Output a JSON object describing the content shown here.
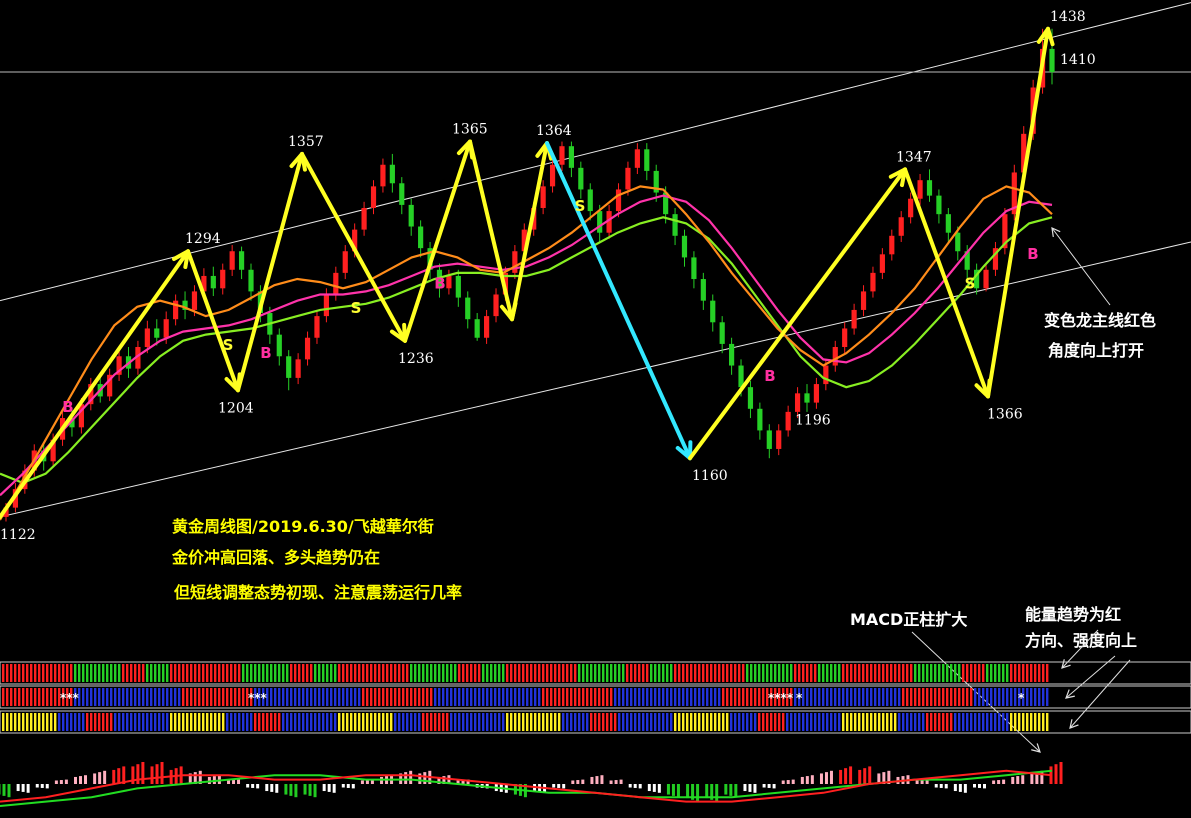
{
  "chart_data": {
    "type": "candlestick",
    "x_range": [
      0,
      1070
    ],
    "price_range": [
      1120,
      1445
    ],
    "candles": [
      [
        1122,
        1128,
        1119,
        1131
      ],
      [
        1128,
        1140,
        1125,
        1144
      ],
      [
        1140,
        1152,
        1137,
        1156
      ],
      [
        1152,
        1165,
        1148,
        1169
      ],
      [
        1165,
        1158,
        1152,
        1170
      ],
      [
        1158,
        1172,
        1155,
        1176
      ],
      [
        1172,
        1186,
        1168,
        1190
      ],
      [
        1186,
        1180,
        1174,
        1192
      ],
      [
        1180,
        1195,
        1176,
        1199
      ],
      [
        1195,
        1208,
        1191,
        1212
      ],
      [
        1208,
        1200,
        1196,
        1214
      ],
      [
        1200,
        1214,
        1197,
        1218
      ],
      [
        1214,
        1226,
        1210,
        1231
      ],
      [
        1226,
        1218,
        1212,
        1232
      ],
      [
        1218,
        1232,
        1214,
        1236
      ],
      [
        1232,
        1244,
        1228,
        1249
      ],
      [
        1244,
        1238,
        1233,
        1250
      ],
      [
        1238,
        1250,
        1234,
        1255
      ],
      [
        1250,
        1262,
        1246,
        1266
      ],
      [
        1262,
        1256,
        1250,
        1268
      ],
      [
        1256,
        1268,
        1252,
        1272
      ],
      [
        1268,
        1278,
        1264,
        1283
      ],
      [
        1278,
        1270,
        1265,
        1284
      ],
      [
        1270,
        1282,
        1266,
        1286
      ],
      [
        1282,
        1294,
        1278,
        1298
      ],
      [
        1294,
        1282,
        1276,
        1297
      ],
      [
        1282,
        1268,
        1262,
        1286
      ],
      [
        1268,
        1254,
        1248,
        1272
      ],
      [
        1254,
        1240,
        1234,
        1258
      ],
      [
        1240,
        1226,
        1220,
        1244
      ],
      [
        1226,
        1212,
        1204,
        1230
      ],
      [
        1212,
        1224,
        1208,
        1228
      ],
      [
        1224,
        1238,
        1220,
        1242
      ],
      [
        1238,
        1252,
        1234,
        1256
      ],
      [
        1252,
        1266,
        1248,
        1270
      ],
      [
        1266,
        1280,
        1262,
        1284
      ],
      [
        1280,
        1294,
        1276,
        1298
      ],
      [
        1294,
        1308,
        1290,
        1312
      ],
      [
        1308,
        1322,
        1304,
        1326
      ],
      [
        1322,
        1336,
        1318,
        1340
      ],
      [
        1336,
        1350,
        1332,
        1354
      ],
      [
        1350,
        1338,
        1332,
        1357
      ],
      [
        1338,
        1324,
        1318,
        1342
      ],
      [
        1324,
        1310,
        1304,
        1328
      ],
      [
        1310,
        1296,
        1290,
        1314
      ],
      [
        1296,
        1282,
        1276,
        1300
      ],
      [
        1282,
        1270,
        1264,
        1286
      ],
      [
        1270,
        1278,
        1266,
        1282
      ],
      [
        1278,
        1264,
        1258,
        1282
      ],
      [
        1264,
        1250,
        1244,
        1268
      ],
      [
        1250,
        1238,
        1236,
        1254
      ],
      [
        1238,
        1252,
        1234,
        1256
      ],
      [
        1252,
        1266,
        1248,
        1270
      ],
      [
        1266,
        1280,
        1262,
        1284
      ],
      [
        1280,
        1294,
        1276,
        1298
      ],
      [
        1294,
        1308,
        1290,
        1312
      ],
      [
        1308,
        1322,
        1304,
        1326
      ],
      [
        1322,
        1336,
        1318,
        1340
      ],
      [
        1336,
        1350,
        1332,
        1354
      ],
      [
        1350,
        1362,
        1346,
        1365
      ],
      [
        1362,
        1348,
        1342,
        1365
      ],
      [
        1348,
        1334,
        1328,
        1352
      ],
      [
        1334,
        1320,
        1314,
        1338
      ],
      [
        1320,
        1306,
        1300,
        1324
      ],
      [
        1306,
        1320,
        1302,
        1324
      ],
      [
        1320,
        1334,
        1316,
        1338
      ],
      [
        1334,
        1348,
        1330,
        1352
      ],
      [
        1348,
        1360,
        1344,
        1364
      ],
      [
        1360,
        1346,
        1340,
        1364
      ],
      [
        1346,
        1332,
        1326,
        1350
      ],
      [
        1332,
        1318,
        1312,
        1336
      ],
      [
        1318,
        1304,
        1298,
        1322
      ],
      [
        1304,
        1290,
        1284,
        1308
      ],
      [
        1290,
        1276,
        1270,
        1294
      ],
      [
        1276,
        1262,
        1256,
        1280
      ],
      [
        1262,
        1248,
        1242,
        1266
      ],
      [
        1248,
        1234,
        1228,
        1252
      ],
      [
        1234,
        1220,
        1214,
        1238
      ],
      [
        1220,
        1206,
        1200,
        1224
      ],
      [
        1206,
        1192,
        1186,
        1210
      ],
      [
        1192,
        1178,
        1172,
        1196
      ],
      [
        1178,
        1166,
        1160,
        1182
      ],
      [
        1166,
        1178,
        1162,
        1182
      ],
      [
        1178,
        1190,
        1174,
        1194
      ],
      [
        1190,
        1202,
        1186,
        1206
      ],
      [
        1202,
        1196,
        1190,
        1208
      ],
      [
        1196,
        1208,
        1192,
        1212
      ],
      [
        1208,
        1220,
        1204,
        1224
      ],
      [
        1220,
        1232,
        1216,
        1236
      ],
      [
        1232,
        1244,
        1228,
        1248
      ],
      [
        1244,
        1256,
        1240,
        1260
      ],
      [
        1256,
        1268,
        1252,
        1272
      ],
      [
        1268,
        1280,
        1264,
        1284
      ],
      [
        1280,
        1292,
        1276,
        1296
      ],
      [
        1292,
        1304,
        1288,
        1308
      ],
      [
        1304,
        1316,
        1300,
        1320
      ],
      [
        1316,
        1328,
        1312,
        1332
      ],
      [
        1328,
        1340,
        1324,
        1344
      ],
      [
        1340,
        1330,
        1326,
        1347
      ],
      [
        1330,
        1318,
        1312,
        1334
      ],
      [
        1318,
        1306,
        1300,
        1322
      ],
      [
        1306,
        1294,
        1288,
        1310
      ],
      [
        1294,
        1282,
        1276,
        1298
      ],
      [
        1282,
        1270,
        1266,
        1286
      ],
      [
        1270,
        1282,
        1268,
        1286
      ],
      [
        1282,
        1296,
        1278,
        1300
      ],
      [
        1296,
        1318,
        1292,
        1322
      ],
      [
        1318,
        1345,
        1314,
        1350
      ],
      [
        1345,
        1370,
        1340,
        1375
      ],
      [
        1370,
        1400,
        1366,
        1405
      ],
      [
        1400,
        1425,
        1396,
        1438
      ],
      [
        1425,
        1410,
        1402,
        1438
      ]
    ],
    "ma_ranges": [
      1140,
      1360
    ],
    "ma_fast": [
      1120,
      1146,
      1172,
      1198,
      1224,
      1246,
      1258,
      1262,
      1258,
      1252,
      1256,
      1264,
      1272,
      1276,
      1274,
      1270,
      1274,
      1282,
      1290,
      1294,
      1290,
      1282,
      1280,
      1288,
      1296,
      1306,
      1318,
      1330,
      1336,
      1334,
      1318,
      1300,
      1280,
      1262,
      1244,
      1230,
      1220,
      1228,
      1240,
      1254,
      1270,
      1290,
      1310,
      1328,
      1336,
      1332,
      1318
    ],
    "ma_slow": [
      1136,
      1150,
      1166,
      1182,
      1198,
      1214,
      1226,
      1236,
      1242,
      1244,
      1246,
      1250,
      1256,
      1262,
      1266,
      1266,
      1268,
      1272,
      1278,
      1284,
      1286,
      1284,
      1282,
      1284,
      1290,
      1298,
      1308,
      1318,
      1326,
      1330,
      1326,
      1314,
      1296,
      1276,
      1256,
      1238,
      1224,
      1222,
      1228,
      1240,
      1254,
      1270,
      1288,
      1306,
      1320,
      1326,
      1324
    ],
    "ma_trend": [
      1150,
      1144,
      1150,
      1164,
      1180,
      1196,
      1212,
      1226,
      1236,
      1240,
      1242,
      1244,
      1248,
      1252,
      1256,
      1258,
      1260,
      1264,
      1270,
      1276,
      1280,
      1280,
      1278,
      1278,
      1282,
      1290,
      1298,
      1306,
      1312,
      1316,
      1312,
      1302,
      1286,
      1266,
      1246,
      1226,
      1212,
      1206,
      1210,
      1220,
      1234,
      1250,
      1266,
      1284,
      1300,
      1312,
      1316
    ],
    "wave_up": [
      [
        0,
        1122
      ],
      [
        188,
        1294
      ],
      [
        238,
        1204
      ],
      [
        302,
        1357
      ],
      [
        405,
        1236
      ],
      [
        470,
        1365
      ],
      [
        512,
        1250
      ],
      [
        547,
        1364
      ]
    ],
    "wave_down": [
      [
        547,
        1364
      ],
      [
        690,
        1160
      ]
    ],
    "wave_up2": [
      [
        690,
        1160
      ],
      [
        905,
        1347
      ],
      [
        988,
        1200
      ],
      [
        1048,
        1438
      ]
    ],
    "price_labels": [
      {
        "text": "1438",
        "x": 1050,
        "v": 1438
      },
      {
        "text": "1410",
        "x": 1060,
        "v": 1410
      },
      {
        "text": "1357",
        "x": 288,
        "v": 1357
      },
      {
        "text": "1365",
        "x": 452,
        "v": 1365
      },
      {
        "text": "1364",
        "x": 536,
        "v": 1364
      },
      {
        "text": "1347",
        "x": 896,
        "v": 1347
      },
      {
        "text": "1294",
        "x": 185,
        "v": 1294
      },
      {
        "text": "1236",
        "x": 398,
        "v": 1236
      },
      {
        "text": "1204",
        "x": 218,
        "v": 1204
      },
      {
        "text": "1366",
        "x": 987,
        "v": 1200
      },
      {
        "text": "1196",
        "x": 795,
        "v": 1196
      },
      {
        "text": "1160",
        "x": 692,
        "v": 1160
      },
      {
        "text": "1122",
        "x": 0,
        "v": 1122
      }
    ],
    "signals": [
      {
        "text": "B",
        "x": 68,
        "v": 1190,
        "kind": "B"
      },
      {
        "text": "S",
        "x": 228,
        "v": 1230,
        "kind": "S"
      },
      {
        "text": "B",
        "x": 266,
        "v": 1225,
        "kind": "B"
      },
      {
        "text": "S",
        "x": 356,
        "v": 1254,
        "kind": "S"
      },
      {
        "text": "B",
        "x": 440,
        "v": 1270,
        "kind": "B"
      },
      {
        "text": "S",
        "x": 580,
        "v": 1320,
        "kind": "S"
      },
      {
        "text": "B",
        "x": 770,
        "v": 1210,
        "kind": "B"
      },
      {
        "text": "S",
        "x": 970,
        "v": 1270,
        "kind": "S"
      },
      {
        "text": "B",
        "x": 1033,
        "v": 1289,
        "kind": "B"
      }
    ],
    "channel_upper": [
      [
        0,
        1262
      ],
      [
        1191,
        1455
      ]
    ],
    "channel_lower": [
      [
        0,
        1122
      ],
      [
        1191,
        1300
      ]
    ],
    "hline": 1410,
    "macd_hist": [
      -6,
      -4,
      -2,
      2,
      4,
      6,
      8,
      10,
      10,
      8,
      6,
      4,
      2,
      -2,
      -4,
      -6,
      -6,
      -4,
      -2,
      2,
      4,
      6,
      6,
      4,
      2,
      -2,
      -4,
      -6,
      -4,
      -2,
      2,
      4,
      2,
      -2,
      -4,
      -6,
      -8,
      -8,
      -6,
      -4,
      -2,
      2,
      4,
      6,
      8,
      8,
      6,
      4,
      2,
      -2,
      -4,
      -2,
      2,
      4,
      6,
      10
    ],
    "macd_line": [
      -8,
      -6,
      -2,
      2,
      4,
      4,
      2,
      2,
      4,
      4,
      2,
      0,
      -2,
      -4,
      -6,
      -8,
      -8,
      -6,
      -4,
      0,
      2,
      4,
      6,
      4
    ],
    "macd_signal": [
      -10,
      -8,
      -6,
      -2,
      0,
      2,
      4,
      4,
      2,
      2,
      0,
      -2,
      -4,
      -4,
      -6,
      -6,
      -6,
      -4,
      -2,
      0,
      2,
      2,
      4,
      6
    ],
    "annotations": {
      "title": "黄金周线图/2019.6.30/飞越華尔街",
      "line2": "金价冲高回落、多头趋势仍在",
      "line3": "但短线调整态势初现、注意震荡运行几率",
      "dragon_1": "变色龙主线红色",
      "dragon_2": "角度向上打开",
      "macd_note": "MACD正柱扩大",
      "energy_1": "能量趋势为红",
      "energy_2": "方向、强度向上"
    },
    "markers": [
      {
        "text": "***",
        "x": 60,
        "row": 2
      },
      {
        "text": "***",
        "x": 248,
        "row": 2
      },
      {
        "text": "****",
        "x": 768,
        "row": 2
      },
      {
        "text": "*",
        "x": 796,
        "row": 2
      },
      {
        "text": "*",
        "x": 1018,
        "row": 2
      }
    ]
  },
  "colors": {
    "up": "#ff2020",
    "down": "#26d026",
    "wave_yellow": "#ffff22",
    "wave_cyan": "#33e8ff",
    "ma_fast": "#ff8c1a",
    "ma_slow": "#ff33aa",
    "ma_trend": "#88ee22",
    "text_yellow": "#ffff00",
    "text_white": "#ffffff",
    "bar_blue": "#2233dd",
    "bar_yellow": "#ffee22"
  }
}
